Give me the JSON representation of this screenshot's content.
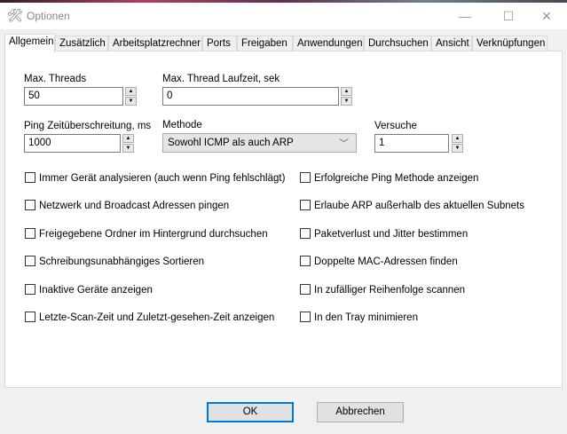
{
  "window": {
    "title": "Optionen",
    "minimize": "—",
    "maximize": "☐",
    "close": "✕"
  },
  "tabs": [
    "Allgemein",
    "Zusätzlich",
    "Arbeitsplatzrechner",
    "Ports",
    "Freigaben",
    "Anwendungen",
    "Durchsuchen",
    "Ansicht",
    "Verknüpfungen"
  ],
  "fields": {
    "max_threads": {
      "label": "Max. Threads",
      "value": "50"
    },
    "max_thread_time": {
      "label": "Max. Thread Laufzeit, sek",
      "value": "0"
    },
    "ping_timeout": {
      "label": "Ping Zeitüberschreitung, ms",
      "value": "1000"
    },
    "method": {
      "label": "Methode",
      "value": "Sowohl ICMP als auch ARP"
    },
    "attempts": {
      "label": "Versuche",
      "value": "1"
    }
  },
  "checkboxes_left": [
    "Immer Gerät analysieren (auch wenn Ping fehlschlägt)",
    "Netzwerk und Broadcast Adressen pingen",
    "Freigegebene Ordner im Hintergrund durchsuchen",
    "Schreibungsunabhängiges Sortieren",
    "Inaktive Geräte anzeigen",
    "Letzte-Scan-Zeit und Zuletzt-gesehen-Zeit anzeigen"
  ],
  "checkboxes_right": [
    "Erfolgreiche Ping Methode anzeigen",
    "Erlaube ARP außerhalb des aktuellen Subnets",
    "Paketverlust und Jitter bestimmen",
    "Doppelte MAC-Adressen finden",
    "In zufälliger Reihenfolge scannen",
    "In den Tray minimieren"
  ],
  "buttons": {
    "ok": "OK",
    "cancel": "Abbrechen"
  }
}
